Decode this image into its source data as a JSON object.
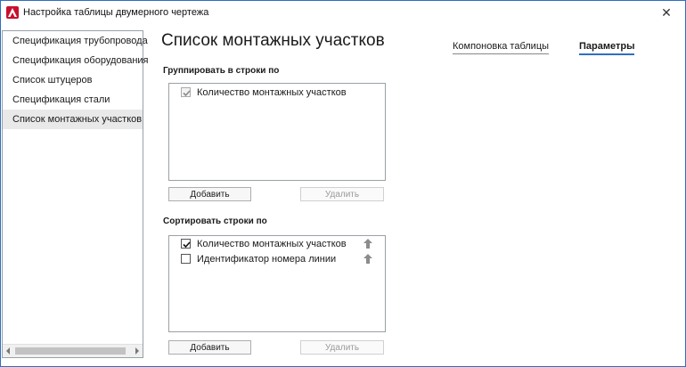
{
  "window": {
    "title": "Настройка таблицы двумерного чертежа",
    "close_glyph": "✕",
    "app_icon": "autocad-a-icon"
  },
  "sidebar": {
    "items": [
      {
        "label": "Спецификация трубопровода",
        "selected": false
      },
      {
        "label": "Спецификация оборудования",
        "selected": false
      },
      {
        "label": "Список штуцеров",
        "selected": false
      },
      {
        "label": "Спецификация стали",
        "selected": false
      },
      {
        "label": "Список монтажных участков",
        "selected": true
      }
    ]
  },
  "main": {
    "title": "Список монтажных участков",
    "tabs": {
      "layout": "Компоновка таблицы",
      "params": "Параметры",
      "active": "params"
    },
    "group": {
      "label": "Группировать в строки по",
      "rows": [
        {
          "label": "Количество монтажных участков",
          "checked": true,
          "disabled": true
        }
      ],
      "add_label": "Добавить",
      "remove_label": "Удалить"
    },
    "sort": {
      "label": "Сортировать строки по",
      "rows": [
        {
          "label": "Количество монтажных участков",
          "checked": true,
          "icon": "arrow-up-icon"
        },
        {
          "label": "Идентификатор номера линии",
          "checked": false,
          "icon": "arrow-up-icon"
        }
      ],
      "add_label": "Добавить",
      "remove_label": "Удалить"
    }
  },
  "colors": {
    "accent": "#2f6fbf",
    "brand": "#c8102e",
    "selected_bg": "#e9e9e9"
  }
}
